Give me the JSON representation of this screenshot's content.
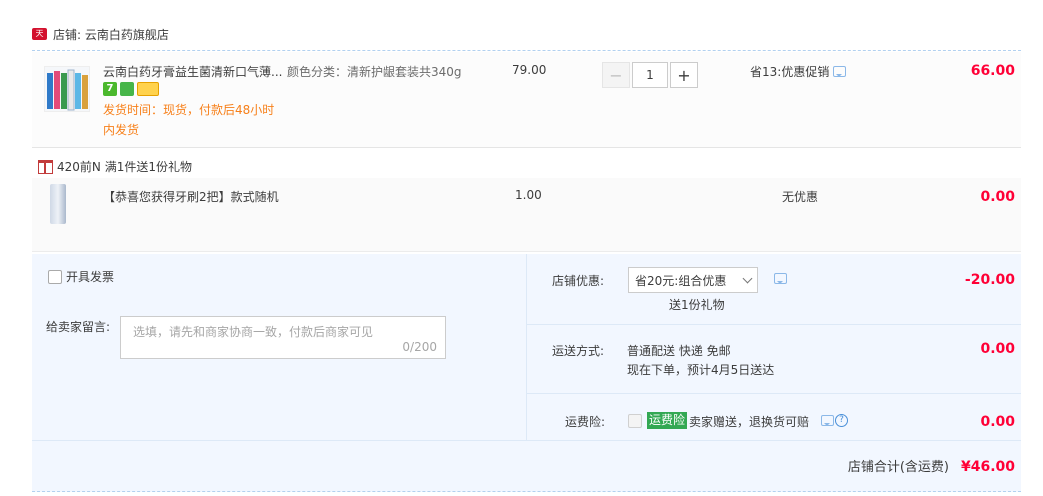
{
  "shop": {
    "badge": "天猫",
    "label": "店铺: 云南白药旗舰店"
  },
  "item": {
    "title": "云南白药牙膏益生菌清新口气薄...",
    "ship_note": "发货时间：现货，付款后48小时内发货",
    "sku": "颜色分类：清新护龈套装共340g",
    "unit_price": "79.00",
    "quantity": "1",
    "minus": "−",
    "plus": "+",
    "promo": "省13:优惠促销",
    "total": "66.00",
    "icon1": "7"
  },
  "gift": {
    "header": "420前N  满1件送1份礼物",
    "title": "【恭喜您获得牙刷2把】款式随机",
    "price": "1.00",
    "promo": "无优惠",
    "total": "0.00"
  },
  "order": {
    "invoice": "开具发票",
    "message_label": "给卖家留言:",
    "message_placeholder": "选填，请先和商家协商一致，付款后商家可见",
    "message_count": "0/200",
    "shop_discount_label": "店铺优惠:",
    "shop_discount_value": "省20元:组合优惠",
    "shop_discount_gift": "送1份礼物",
    "shop_discount_amount": "-20.00",
    "shipping_label": "运送方式:",
    "shipping_line1": "普通配送 快递 免邮",
    "shipping_line2": "现在下单，预计4月5日送达",
    "shipping_amount": "0.00",
    "insurance_label": "运费险:",
    "insurance_tag": "运费险",
    "insurance_text": "卖家赠送，退换货可赔",
    "insurance_amount": "0.00",
    "total_label": "店铺合计(含运费)",
    "total_value": "¥46.00"
  }
}
